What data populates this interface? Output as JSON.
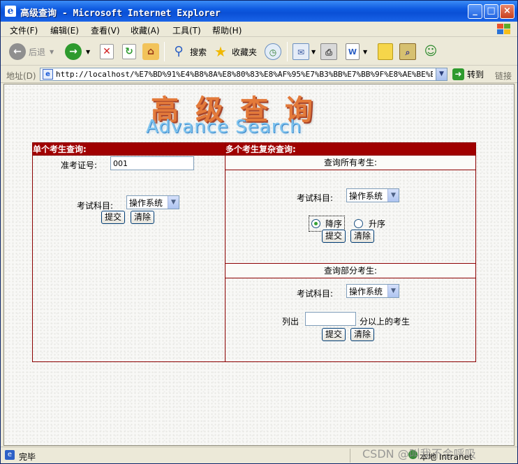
{
  "window": {
    "title": "高级查询 - Microsoft Internet Explorer",
    "minimize": "_",
    "maximize": "□",
    "close": "×"
  },
  "menu": [
    "文件(F)",
    "编辑(E)",
    "查看(V)",
    "收藏(A)",
    "工具(T)",
    "帮助(H)"
  ],
  "toolbar": {
    "back": "后退",
    "search": "搜索",
    "favorites": "收藏夹"
  },
  "address": {
    "label": "地址(D)",
    "url": "http://localhost/%E7%BD%91%E4%B8%8A%E8%80%83%E8%AF%95%E7%B3%BB%E7%BB%9F%E8%AE%BE%E8%AE%A1%E",
    "go": "转到",
    "links": "链接"
  },
  "page": {
    "logo_cn": "高级查询",
    "logo_en": "Advance Search",
    "single": {
      "header": "单个考生查询:",
      "id_label": "准考证号:",
      "id_value": "001",
      "subject_label": "考试科目:",
      "subject_value": "操作系统",
      "submit": "提交",
      "clear": "清除"
    },
    "multi": {
      "header": "多个考生复杂查询:",
      "all": {
        "title": "查询所有考生:",
        "subject_label": "考试科目:",
        "subject_value": "操作系统",
        "desc": "降序",
        "asc": "升序",
        "submit": "提交",
        "clear": "清除"
      },
      "partial": {
        "title": "查询部分考生:",
        "subject_label": "考试科目:",
        "subject_value": "操作系统",
        "list_prefix": "列出",
        "score_value": "",
        "list_suffix": "分以上的考生",
        "submit": "提交",
        "clear": "清除"
      }
    }
  },
  "status": {
    "text": "完毕",
    "zone": "本地 Intranet"
  },
  "watermark": "CSDN @叫我不会呼吸"
}
